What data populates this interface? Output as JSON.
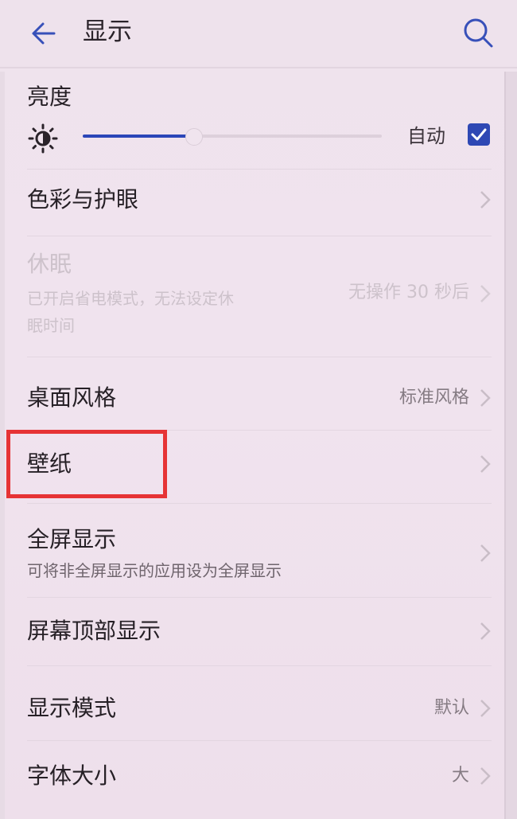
{
  "header": {
    "title": "显示",
    "back_icon": "arrow-left-icon",
    "search_icon": "search-icon"
  },
  "brightness": {
    "label": "亮度",
    "icon": "sun-icon",
    "level": 0.37,
    "auto_label": "自动",
    "auto_checked": true
  },
  "items": [
    {
      "key": "color",
      "label": "色彩与护眼",
      "sub": "",
      "value": "",
      "disabled": false
    },
    {
      "key": "sleep",
      "label": "休眠",
      "sub_lines": [
        "已开启省电模式，无法设定休",
        "眠时间"
      ],
      "value": "无操作 30 秒后",
      "disabled": true
    },
    {
      "key": "desktop-style",
      "label": "桌面风格",
      "sub": "",
      "value": "标准风格",
      "disabled": false
    },
    {
      "key": "wallpaper",
      "label": "壁纸",
      "sub": "",
      "value": "",
      "disabled": false,
      "highlighted": true
    },
    {
      "key": "fullscreen",
      "label": "全屏显示",
      "sub": "可将非全屏显示的应用设为全屏显示",
      "value": "",
      "disabled": false
    },
    {
      "key": "top-display",
      "label": "屏幕顶部显示",
      "sub": "",
      "value": "",
      "disabled": false
    },
    {
      "key": "display-mode",
      "label": "显示模式",
      "sub": "",
      "value": "默认",
      "disabled": false
    },
    {
      "key": "font-size",
      "label": "字体大小",
      "sub": "",
      "value": "大",
      "disabled": false
    }
  ],
  "colors": {
    "accent": "#2b46b8",
    "highlight": "#e63335",
    "background": "#efe3ed"
  }
}
